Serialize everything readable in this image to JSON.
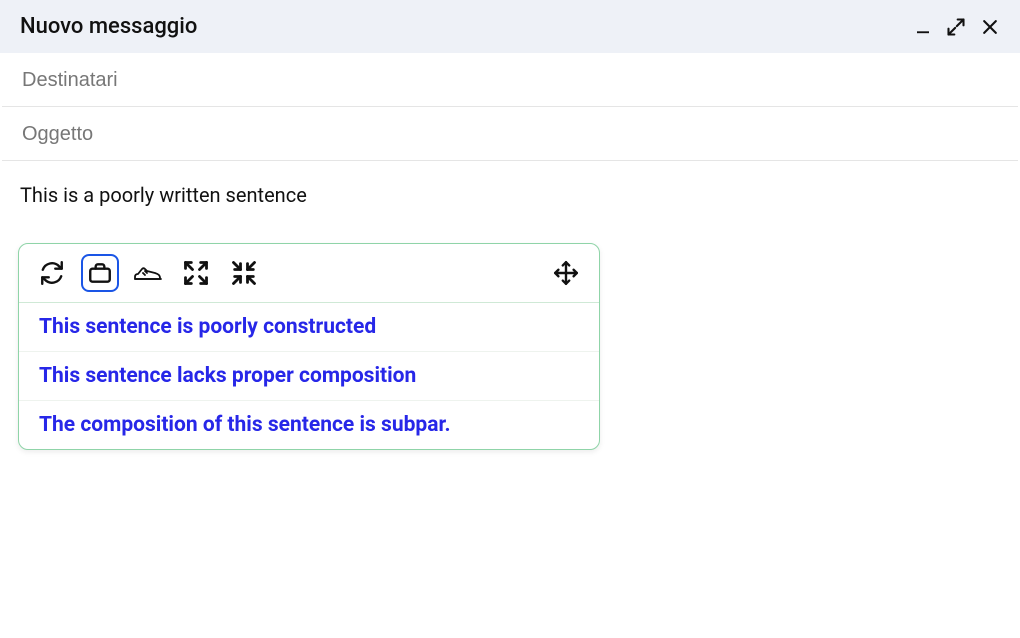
{
  "header": {
    "title": "Nuovo messaggio"
  },
  "fields": {
    "recipients_placeholder": "Destinatari",
    "subject_placeholder": "Oggetto"
  },
  "body": {
    "text": "This is a poorly written sentence"
  },
  "suggestions": {
    "items": [
      "This sentence is poorly constructed",
      "This sentence lacks proper composition",
      "The composition of this sentence is subpar."
    ]
  }
}
